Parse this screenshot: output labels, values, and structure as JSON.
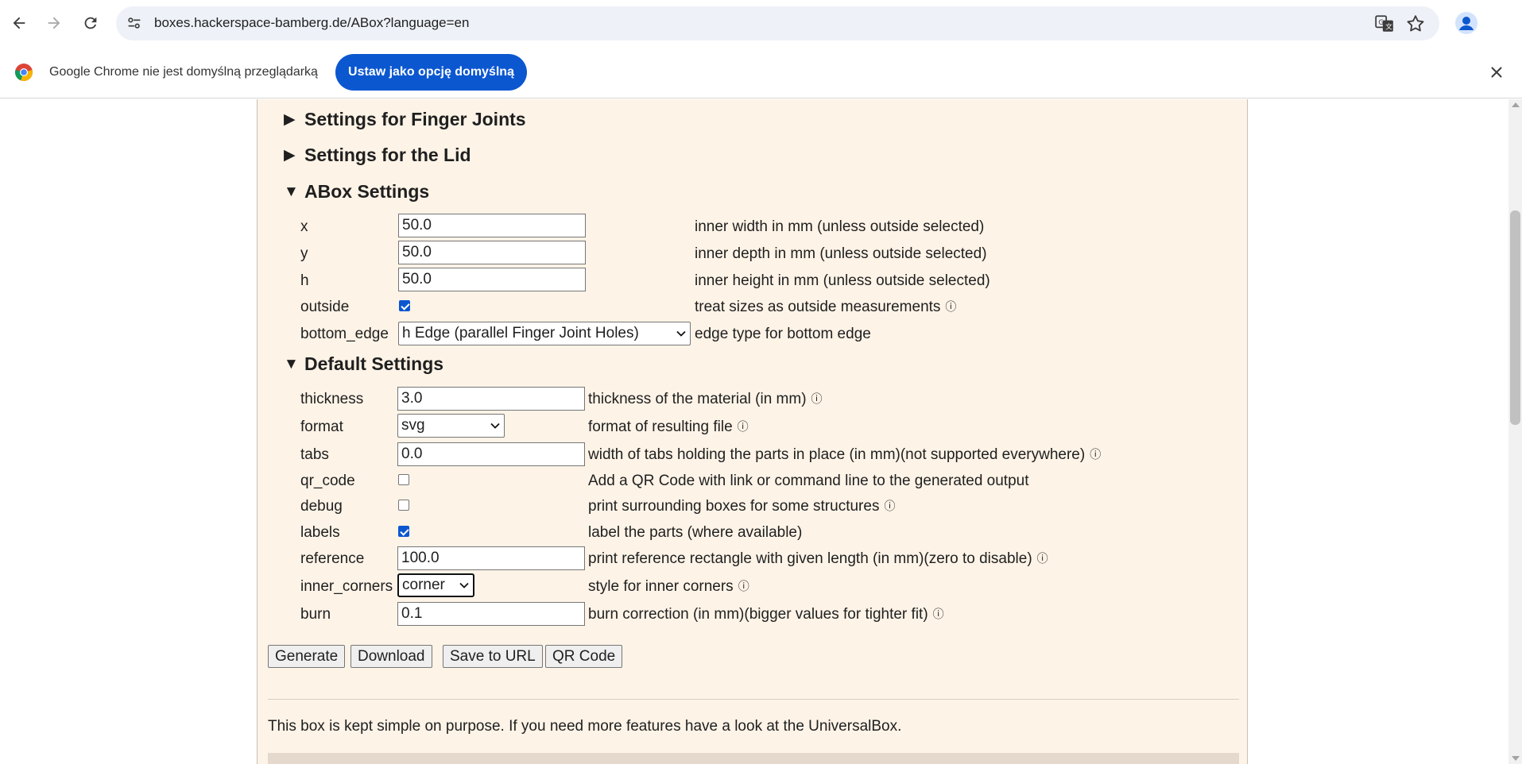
{
  "browser": {
    "url": "boxes.hackerspace-bamberg.de/ABox?language=en",
    "infobar_message": "Google Chrome nie jest domyślną przeglądarką",
    "infobar_button": "Ustaw jako opcję domyślną"
  },
  "sections": {
    "finger_joints": "Settings for Finger Joints",
    "lid": "Settings for the Lid",
    "abox": "ABox Settings",
    "default": "Default Settings"
  },
  "abox": {
    "x": {
      "label": "x",
      "value": "50.0",
      "desc": "inner width in mm (unless outside selected)"
    },
    "y": {
      "label": "y",
      "value": "50.0",
      "desc": "inner depth in mm (unless outside selected)"
    },
    "h": {
      "label": "h",
      "value": "50.0",
      "desc": "inner height in mm (unless outside selected)"
    },
    "outside": {
      "label": "outside",
      "checked": true,
      "desc": "treat sizes as outside measurements"
    },
    "bottom_edge": {
      "label": "bottom_edge",
      "value": "h Edge (parallel Finger Joint Holes)",
      "desc": "edge type for bottom edge"
    }
  },
  "defaults": {
    "thickness": {
      "label": "thickness",
      "value": "3.0",
      "desc": "thickness of the material (in mm)"
    },
    "format": {
      "label": "format",
      "value": "svg",
      "desc": "format of resulting file"
    },
    "tabs": {
      "label": "tabs",
      "value": "0.0",
      "desc": "width of tabs holding the parts in place (in mm)(not supported everywhere)"
    },
    "qr_code": {
      "label": "qr_code",
      "checked": false,
      "desc": "Add a QR Code with link or command line to the generated output"
    },
    "debug": {
      "label": "debug",
      "checked": false,
      "desc": "print surrounding boxes for some structures"
    },
    "labels": {
      "label": "labels",
      "checked": true,
      "desc": "label the parts (where available)"
    },
    "reference": {
      "label": "reference",
      "value": "100.0",
      "desc": "print reference rectangle with given length (in mm)(zero to disable)"
    },
    "inner_corners": {
      "label": "inner_corners",
      "value": "corner",
      "desc": "style for inner corners"
    },
    "burn": {
      "label": "burn",
      "value": "0.1",
      "desc": "burn correction (in mm)(bigger values for tighter fit)"
    }
  },
  "buttons": {
    "generate": "Generate",
    "download": "Download",
    "save_url": "Save to URL",
    "qr": "QR Code"
  },
  "info_glyph": "ⓘ",
  "footer": {
    "text": "This box is kept simple on purpose. If you need more features have a look at the UniversalBox."
  },
  "colors": {
    "panel_bg": "#fdf3e7",
    "accent": "#0b57d0"
  }
}
